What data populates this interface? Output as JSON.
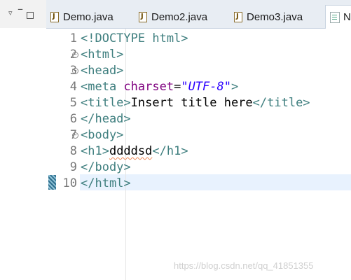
{
  "tabs": [
    {
      "label": "Demo.java",
      "active": false
    },
    {
      "label": "Demo2.java",
      "active": false
    },
    {
      "label": "Demo3.java",
      "active": false
    },
    {
      "label": "Ne",
      "active": true
    }
  ],
  "editor": {
    "lines": [
      {
        "num": "1",
        "fold": false,
        "parts": [
          {
            "cls": "tagc",
            "text": "<!DOCTYPE html>"
          }
        ]
      },
      {
        "num": "2",
        "fold": true,
        "parts": [
          {
            "cls": "tagc",
            "text": "<html>"
          }
        ]
      },
      {
        "num": "3",
        "fold": true,
        "parts": [
          {
            "cls": "tagc",
            "text": "<head>"
          }
        ]
      },
      {
        "num": "4",
        "fold": false,
        "parts": [
          {
            "cls": "tagc",
            "text": "<meta "
          },
          {
            "cls": "attr",
            "text": "charset"
          },
          {
            "cls": "txt",
            "text": "="
          },
          {
            "cls": "val",
            "text": "\"UTF-8\""
          },
          {
            "cls": "tagc",
            "text": ">"
          }
        ]
      },
      {
        "num": "5",
        "fold": false,
        "parts": [
          {
            "cls": "tagc",
            "text": "<title>"
          },
          {
            "cls": "txt",
            "text": "Insert title here"
          },
          {
            "cls": "tagc",
            "text": "</title>"
          }
        ]
      },
      {
        "num": "6",
        "fold": false,
        "parts": [
          {
            "cls": "tagc",
            "text": "</head>"
          }
        ]
      },
      {
        "num": "7",
        "fold": true,
        "parts": [
          {
            "cls": "tagc",
            "text": "<body>"
          }
        ]
      },
      {
        "num": "8",
        "fold": false,
        "parts": [
          {
            "cls": "tagc",
            "text": "<h1>"
          },
          {
            "cls": "txt squig",
            "text": "ddddsd"
          },
          {
            "cls": "tagc",
            "text": "</h1>"
          }
        ]
      },
      {
        "num": "9",
        "fold": false,
        "parts": [
          {
            "cls": "tagc",
            "text": "</body>"
          }
        ]
      },
      {
        "num": "10",
        "fold": false,
        "parts": [
          {
            "cls": "tagc",
            "text": "</html>"
          }
        ]
      }
    ]
  },
  "watermark": "https://blog.csdn.net/qq_41851355"
}
